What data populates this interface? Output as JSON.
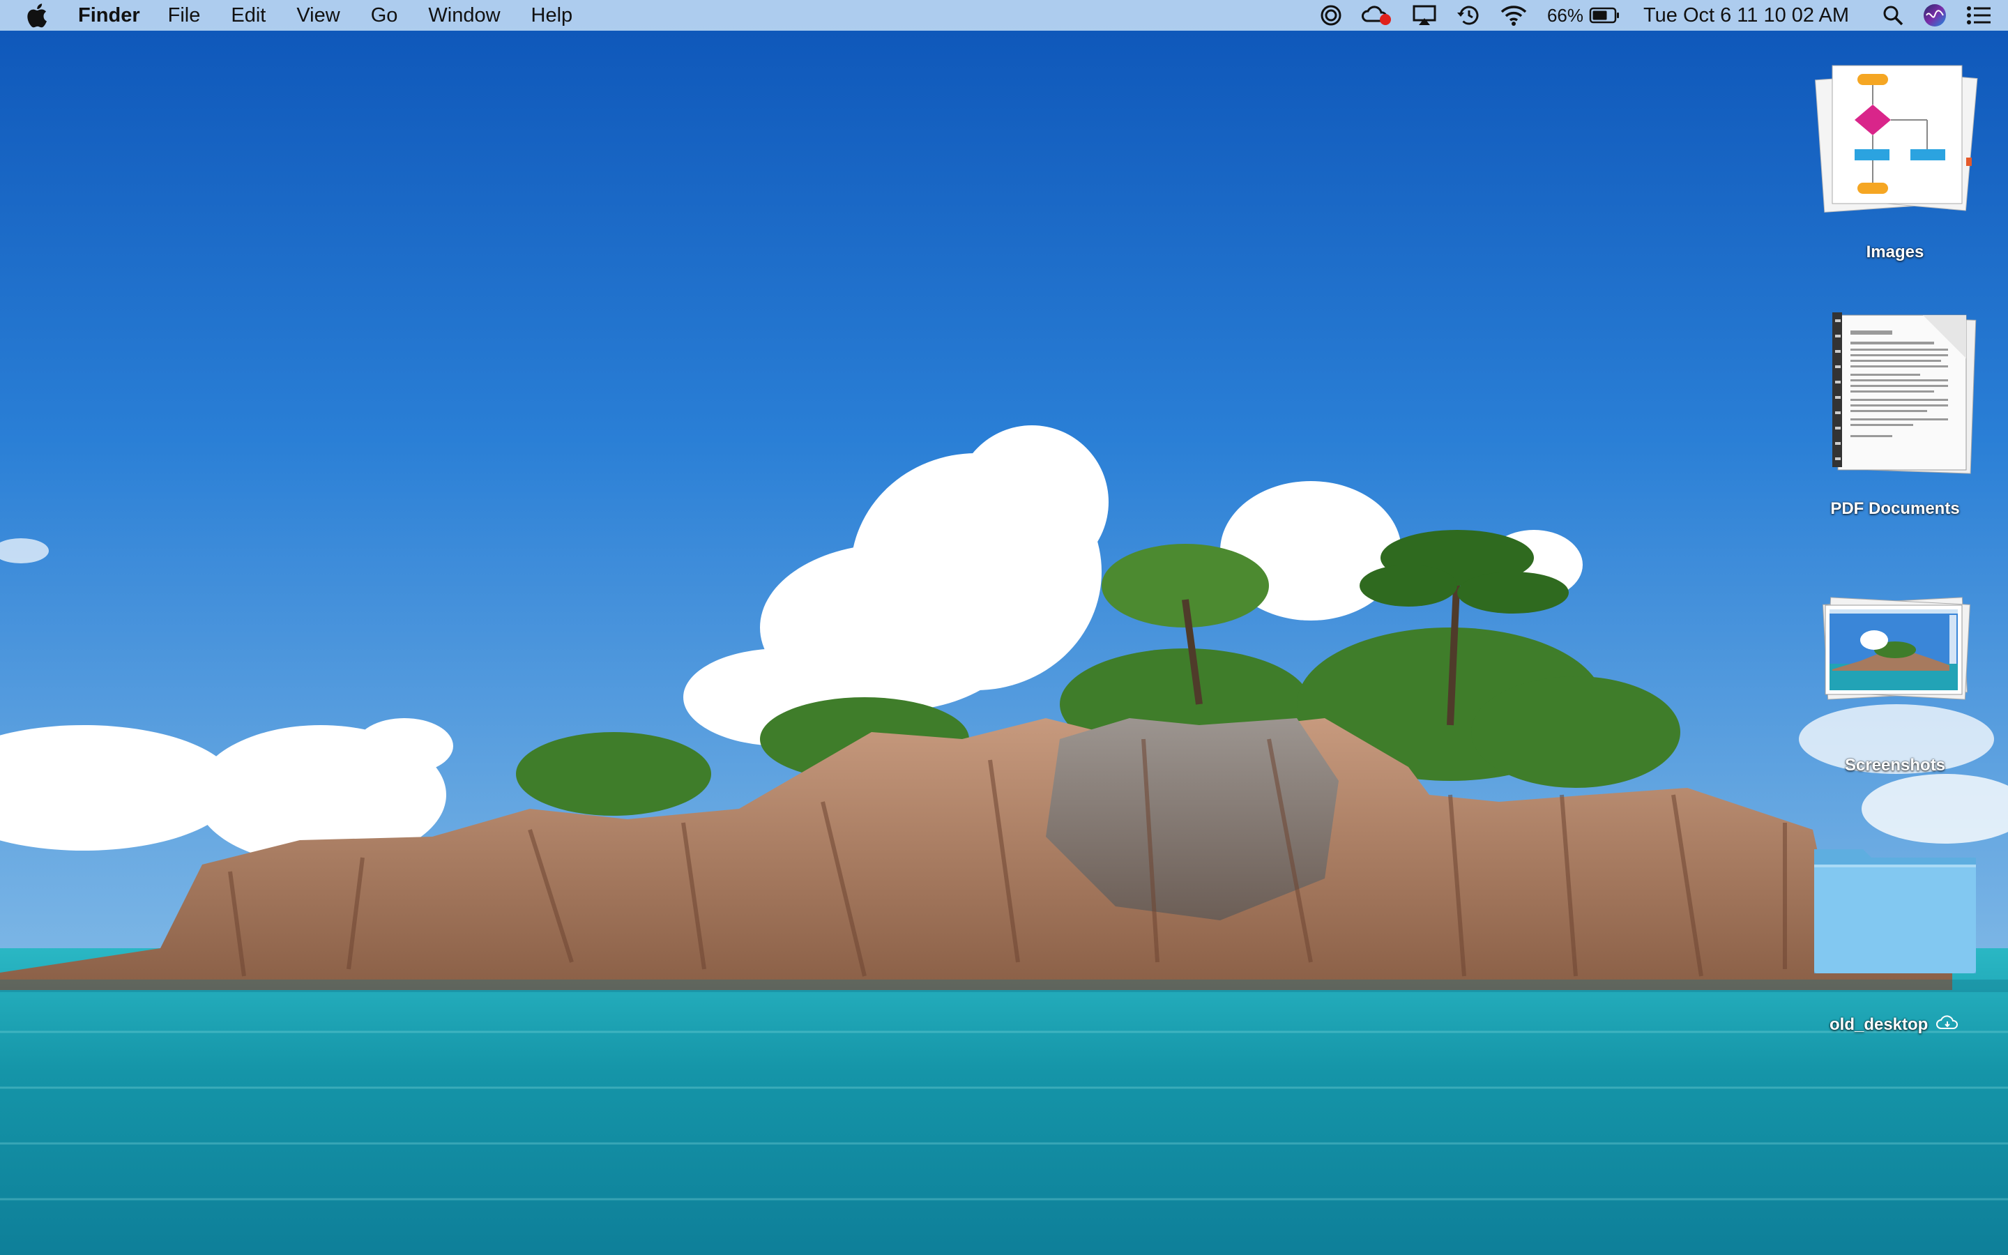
{
  "menubar": {
    "app_name": "Finder",
    "menus": [
      "File",
      "Edit",
      "View",
      "Go",
      "Window",
      "Help"
    ],
    "battery_percent": "66%",
    "clock": "Tue Oct 6  11 10 02 AM",
    "status_icons": [
      "screen-recording-icon",
      "creative-cloud-icon",
      "airplay-icon",
      "time-machine-icon",
      "wifi-icon",
      "battery-icon",
      "spotlight-search-icon",
      "siri-icon",
      "notification-center-icon"
    ]
  },
  "desktop": {
    "items": [
      {
        "label": "Images",
        "type": "stack"
      },
      {
        "label": "PDF Documents",
        "type": "stack"
      },
      {
        "label": "Screenshots",
        "type": "stack"
      },
      {
        "label": "old_desktop",
        "type": "folder"
      }
    ]
  },
  "colors": {
    "menubar_bg": "#c4ddf5",
    "folder": "#7fc6f0",
    "sky": "#1f6fd0",
    "sea": "#23a9b8"
  }
}
